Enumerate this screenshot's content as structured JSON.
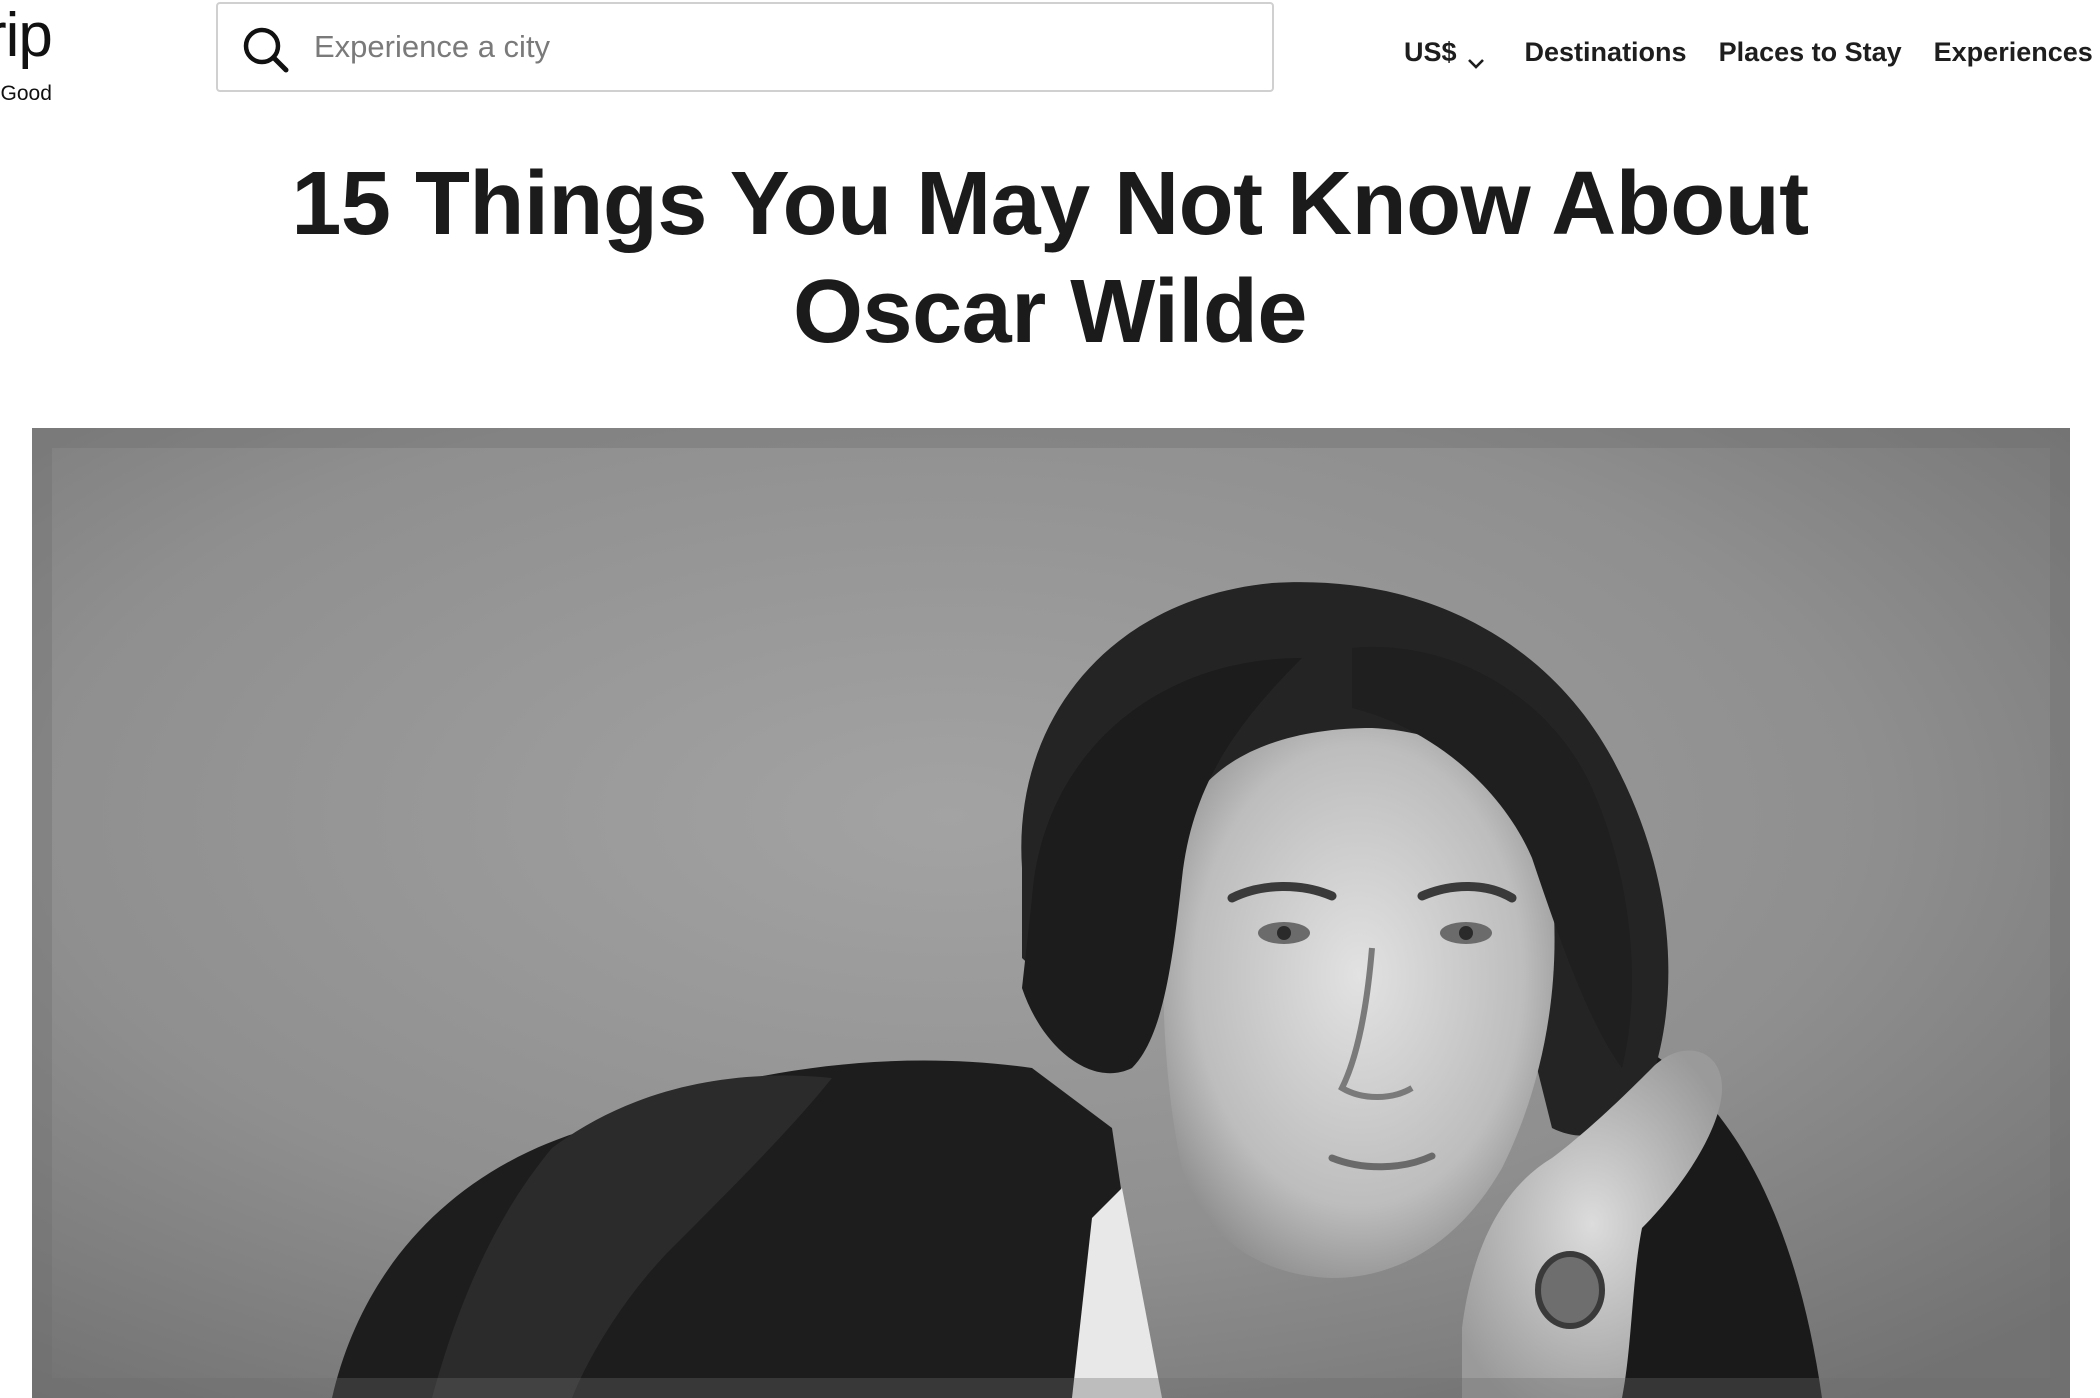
{
  "logo": {
    "wordmark": "rip",
    "tagline": "l Good"
  },
  "search": {
    "placeholder": "Experience a city",
    "value": ""
  },
  "nav": {
    "currency_label": "US$",
    "items": [
      {
        "label": "Destinations"
      },
      {
        "label": "Places to Stay"
      },
      {
        "label": "Experiences"
      }
    ]
  },
  "article": {
    "title_line1": "15 Things You May Not Know About",
    "title_line2": "Oscar Wilde"
  },
  "colors": {
    "text": "#1b1b1b",
    "border": "#d0d0d0",
    "placeholder": "#7a7a7a",
    "background": "#ffffff"
  },
  "icons": {
    "search": "search-icon",
    "currency_dropdown": "chevron-down-icon"
  }
}
